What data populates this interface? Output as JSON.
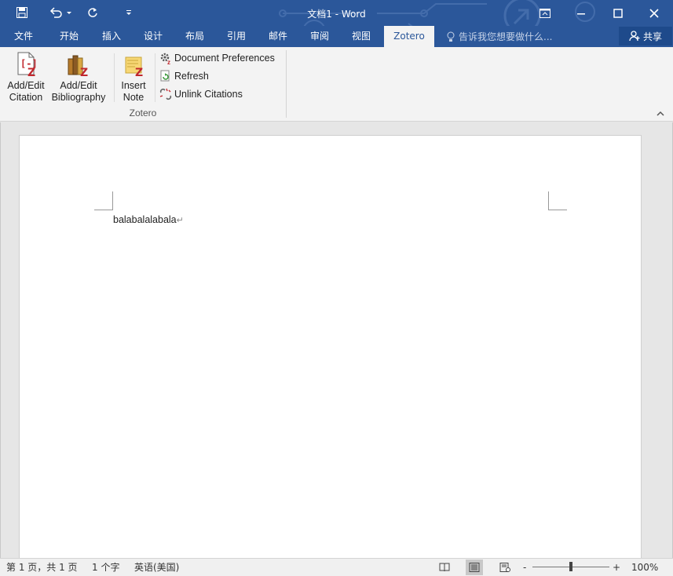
{
  "title_bar": {
    "document_title": "文档1 - Word",
    "qat": [
      "save-icon",
      "undo-icon",
      "redo-icon",
      "customize-icon"
    ],
    "window_controls": [
      "ribbon-display-icon",
      "minimize-icon",
      "maximize-icon",
      "close-icon"
    ]
  },
  "tabs": [
    {
      "label": "文件"
    },
    {
      "label": "开始"
    },
    {
      "label": "插入"
    },
    {
      "label": "设计"
    },
    {
      "label": "布局"
    },
    {
      "label": "引用"
    },
    {
      "label": "邮件"
    },
    {
      "label": "审阅"
    },
    {
      "label": "视图"
    },
    {
      "label": "Zotero",
      "active": true
    }
  ],
  "tell_me": "告诉我您想要做什么...",
  "share": "共享",
  "ribbon": {
    "add_citation": {
      "line1": "Add/Edit",
      "line2": "Citation"
    },
    "add_bibliography": {
      "line1": "Add/Edit",
      "line2": "Bibliography"
    },
    "insert_note": {
      "line1": "Insert",
      "line2": "Note"
    },
    "doc_prefs": "Document Preferences",
    "refresh": "Refresh",
    "unlink": "Unlink Citations",
    "group_label": "Zotero"
  },
  "document": {
    "body_text": "balabalalabala",
    "paragraph_mark": "↵"
  },
  "status_bar": {
    "page": "第 1 页，共 1 页",
    "words": "1 个字",
    "language": "英语(美国)",
    "zoom": "100%",
    "zoom_minus": "-",
    "zoom_plus": "+"
  },
  "colors": {
    "brand": "#2b579a",
    "ribbon_bg": "#f3f3f3",
    "zotero_red": "#c0272d"
  }
}
